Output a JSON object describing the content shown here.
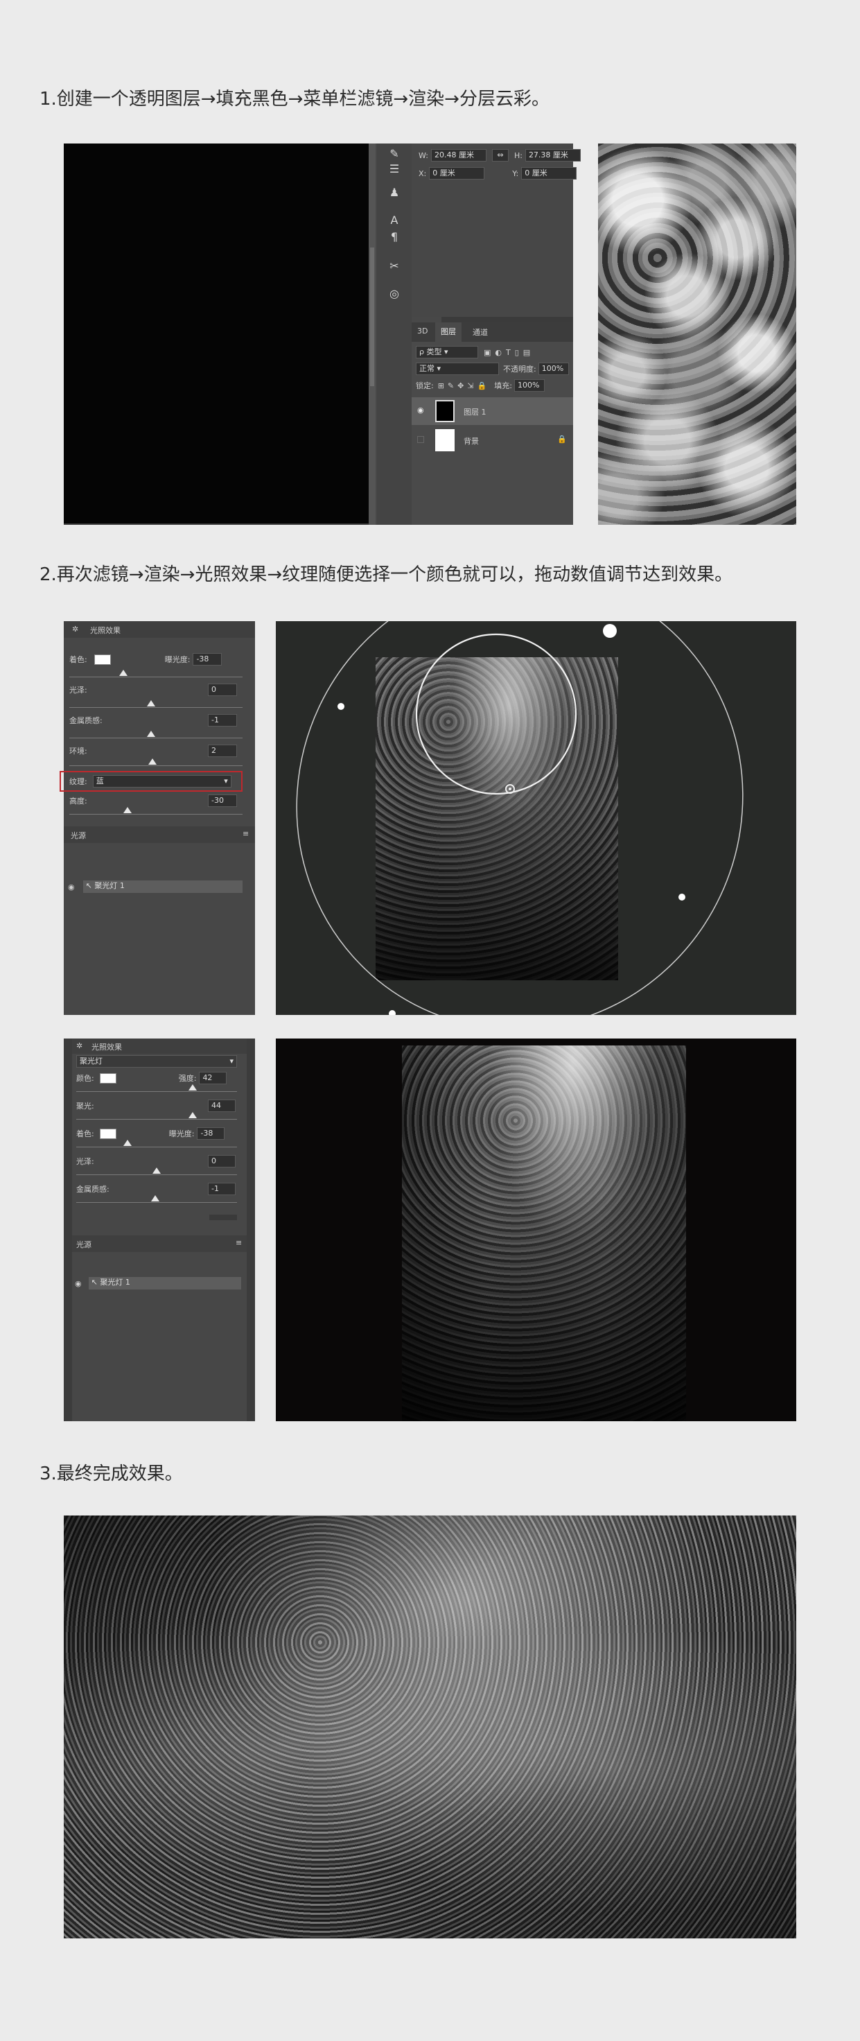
{
  "steps": [
    {
      "title": "1.创建一个透明图层→填充黑色→菜单栏滤镜→渲染→分层云彩。"
    },
    {
      "title": "2.再次滤镜→渲染→光照效果→纹理随便选择一个颜色就可以，拖动数值调节达到效果。"
    },
    {
      "title": "3.最终完成效果。"
    }
  ],
  "props_panel": {
    "w_label": "W:",
    "w_value": "20.48 厘米",
    "h_label": "H:",
    "h_value": "27.38 厘米",
    "x_label": "X:",
    "x_value": "0 厘米",
    "y_label": "Y:",
    "y_value": "0 厘米",
    "link_icon": "link-icon"
  },
  "layers_panel": {
    "tabs": [
      "3D",
      "图层",
      "通道"
    ],
    "active_tab": "图层",
    "filter_kind": "类型",
    "blend_mode": "正常",
    "opacity_label": "不透明度:",
    "opacity_value": "100%",
    "lock_label": "锁定:",
    "fill_label": "填充:",
    "fill_value": "100%",
    "layers": [
      {
        "name": "图层 1",
        "visible": true,
        "selected": true
      },
      {
        "name": "背景",
        "visible": false,
        "selected": false
      }
    ]
  },
  "lighting_panel_1": {
    "title": "光照效果",
    "rows": [
      {
        "label": "着色:",
        "extra_label": "曝光度:",
        "extra_value": "-38"
      },
      {
        "label": "光泽:",
        "value": "0"
      },
      {
        "label": "金属质感:",
        "value": "-1"
      },
      {
        "label": "环境:",
        "value": "2"
      },
      {
        "label": "纹理:",
        "value": "蓝"
      },
      {
        "label": "高度:",
        "value": "-30"
      }
    ],
    "lights_header": "光源",
    "light_item": "聚光灯 1"
  },
  "lighting_panel_2": {
    "title": "光照效果",
    "preset": "聚光灯",
    "rows": [
      {
        "label": "颜色:",
        "extra_label": "强度:",
        "extra_value": "42"
      },
      {
        "label": "聚光:",
        "value": "44"
      },
      {
        "label": "着色:",
        "extra_label": "曝光度:",
        "extra_value": "-38"
      },
      {
        "label": "光泽:",
        "value": "0"
      },
      {
        "label": "金属质感:",
        "value": "-1"
      }
    ],
    "lights_header": "光源",
    "light_item": "聚光灯 1"
  },
  "colors": {
    "page_bg": "#ebebeb",
    "ps_panel": "#474747",
    "ps_dark": "#282a28",
    "highlight_red": "#c0282d"
  }
}
